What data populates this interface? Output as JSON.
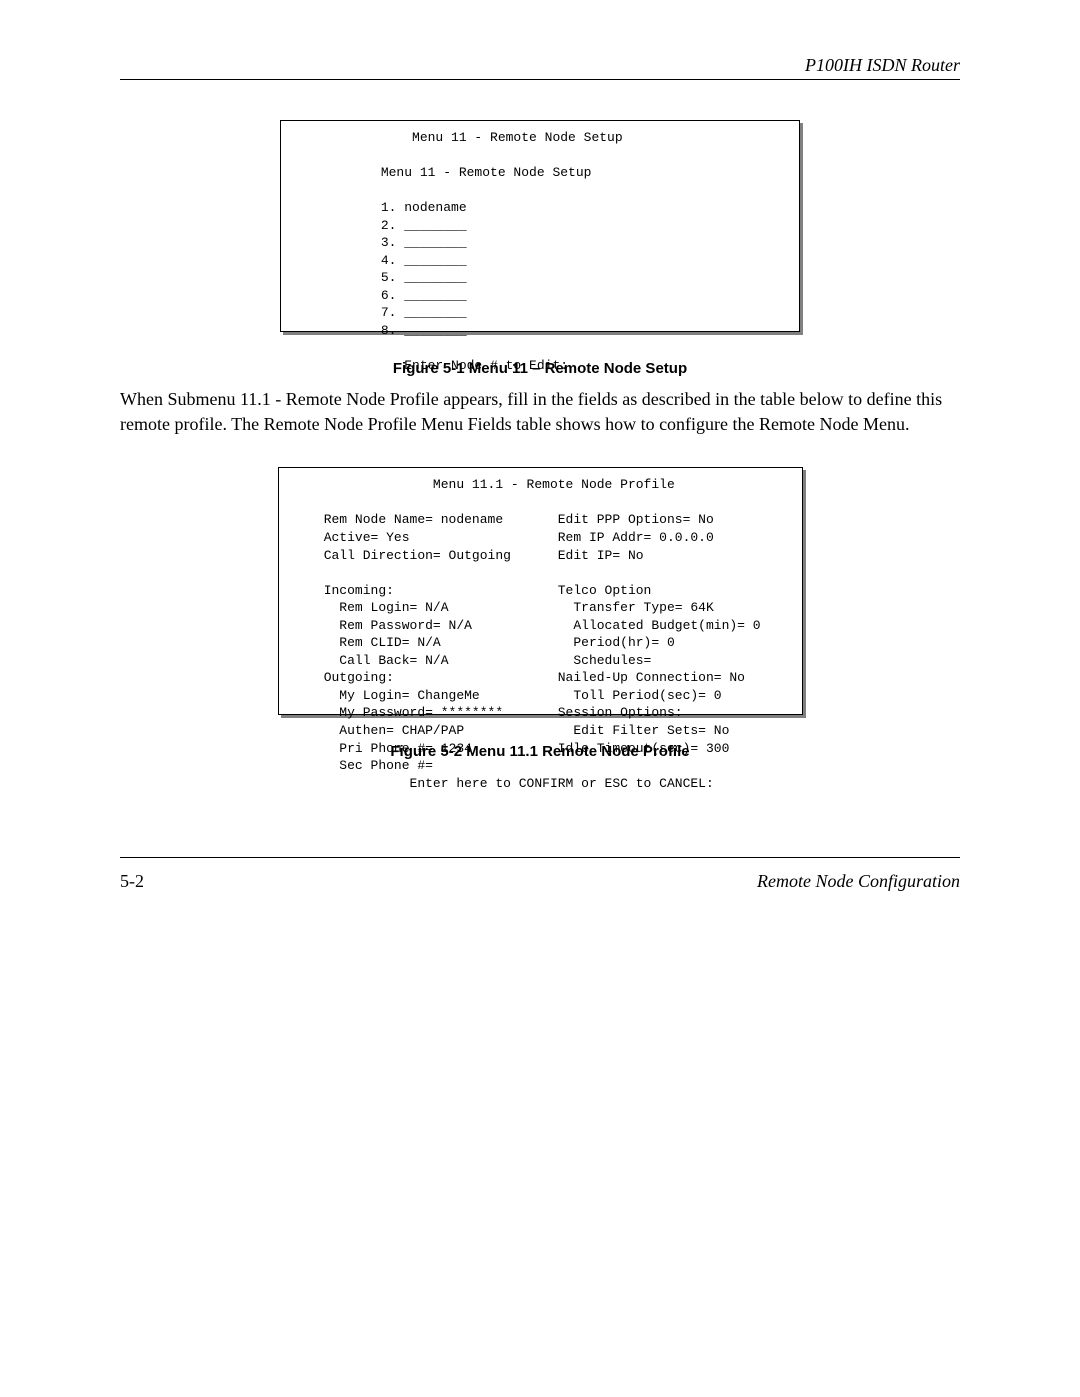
{
  "header": {
    "title": "P100IH ISDN Router"
  },
  "figure1": {
    "title": "Menu 11 - Remote Node Setup",
    "subtitle": "Menu 11 - Remote Node Setup",
    "nodes": [
      "1. nodename",
      "2. ________",
      "3. ________",
      "4. ________",
      "5. ________",
      "6. ________",
      "7. ________",
      "8. ________"
    ],
    "prompt": "Enter Node # to Edit:"
  },
  "caption1": "Figure 5-1 Menu 11 – Remote Node Setup",
  "paragraph": "When Submenu 11.1 - Remote Node Profile appears, fill in the fields as described in the table below to define this remote profile. The Remote Node Profile Menu Fields table shows how to configure the Remote Node Menu.",
  "figure2": {
    "title": "Menu 11.1 - Remote Node Profile",
    "left_col": [
      "Rem Node Name= nodename",
      "Active= Yes",
      "Call Direction= Outgoing",
      "",
      "Incoming:",
      "  Rem Login= N/A",
      "  Rem Password= N/A",
      "  Rem CLID= N/A",
      "  Call Back= N/A",
      "Outgoing:",
      "  My Login= ChangeMe",
      "  My Password= ********",
      "  Authen= CHAP/PAP",
      "  Pri Phone #= 1234",
      "  Sec Phone #="
    ],
    "right_col": [
      "Edit PPP Options= No",
      "Rem IP Addr= 0.0.0.0",
      "Edit IP= No",
      "",
      "Telco Option",
      "  Transfer Type= 64K",
      "  Allocated Budget(min)= 0",
      "  Period(hr)= 0",
      "  Schedules=",
      "Nailed-Up Connection= No",
      "  Toll Period(sec)= 0",
      "Session Options:",
      "  Edit Filter Sets= No",
      "Idle Timeout(sec)= 300",
      ""
    ],
    "footer": "Enter here to CONFIRM or ESC to CANCEL:"
  },
  "caption2": "Figure 5-2 Menu 11.1 Remote Node Profile",
  "footer": {
    "page": "5-2",
    "section": "Remote Node Configuration"
  }
}
